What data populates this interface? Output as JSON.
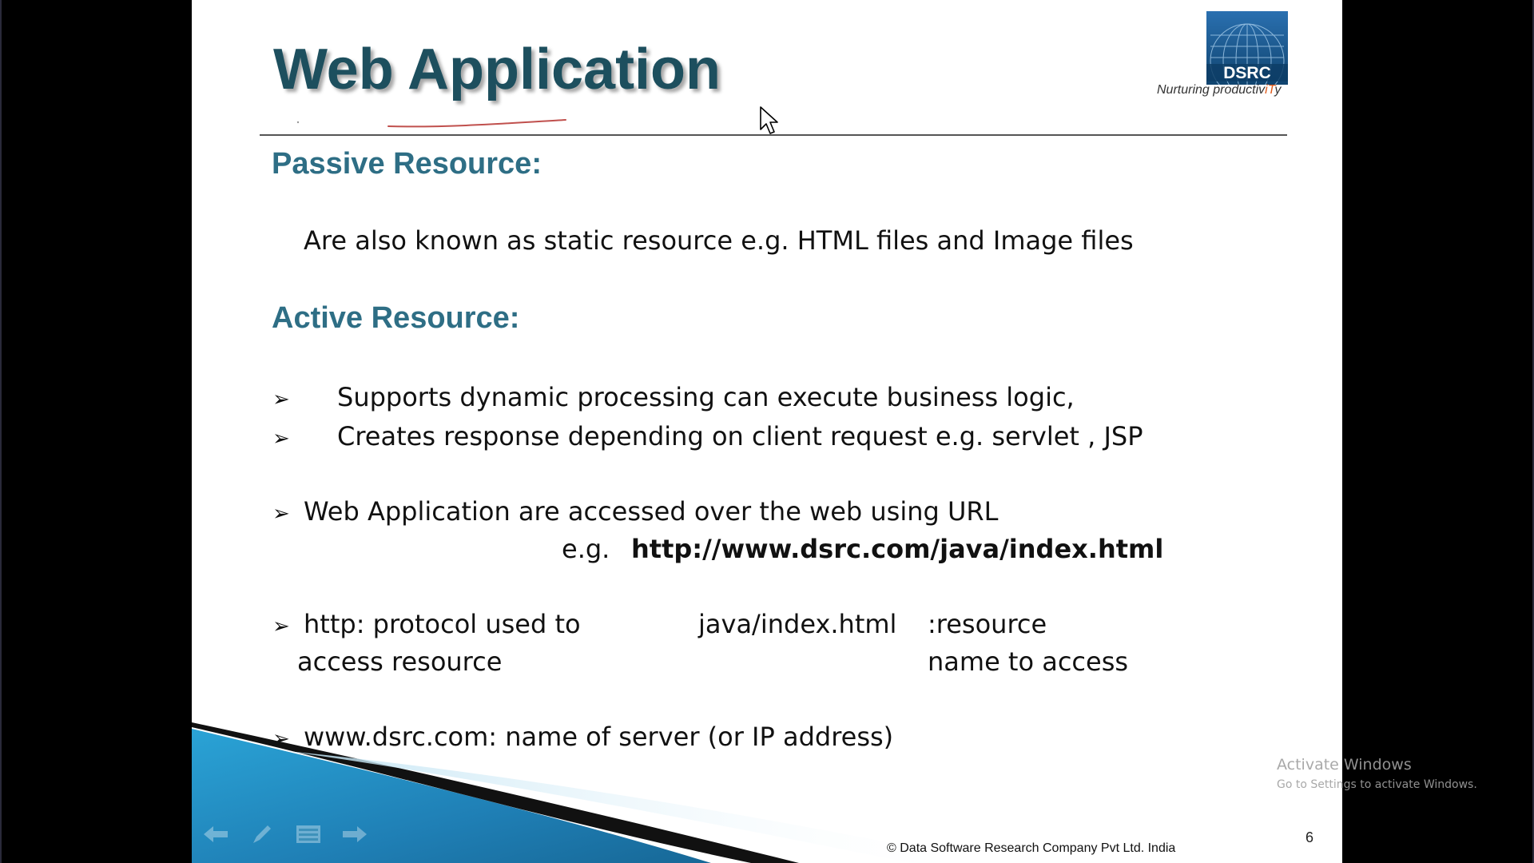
{
  "slide": {
    "title": "Web Application",
    "logo": {
      "brand": "DSRC",
      "tagline_main": "Nurturing productiv",
      "tagline_highlight": "iT",
      "tagline_end": "y"
    },
    "passive": {
      "heading": "Passive Resource:",
      "text": "Are also known as static resource  e.g. HTML files and Image files"
    },
    "active": {
      "heading": "Active Resource:",
      "bullets": [
        "Supports dynamic processing can execute business logic,",
        "Creates response depending on client request e.g.   servlet , JSP"
      ]
    },
    "url_point": {
      "text": "Web Application are accessed over the web using URL",
      "example_prefix": "e.g.",
      "example_url": "http://www.dsrc.com/java/index.html"
    },
    "http_point": {
      "line1_left": "http: protocol used to",
      "line2_left": "access resource",
      "middle": "java/index.html",
      "line1_right": ":resource",
      "line2_right": "name to  access"
    },
    "server_point": {
      "text": "www.dsrc.com: name of server   (or IP address)"
    },
    "bullet_glyph": "➢",
    "copyright": "© Data Software Research Company Pvt Ltd. India",
    "page_number": "6"
  },
  "overlay": {
    "activate_title": "Activate Windows",
    "activate_sub": "Go to Settings to activate Windows."
  },
  "colors": {
    "title": "#1d4f5e",
    "heading": "#2e6e85",
    "logo_blue": "#1a5a9a",
    "footer_blue": "#1a8fc0",
    "highlight": "#e05a1a"
  }
}
